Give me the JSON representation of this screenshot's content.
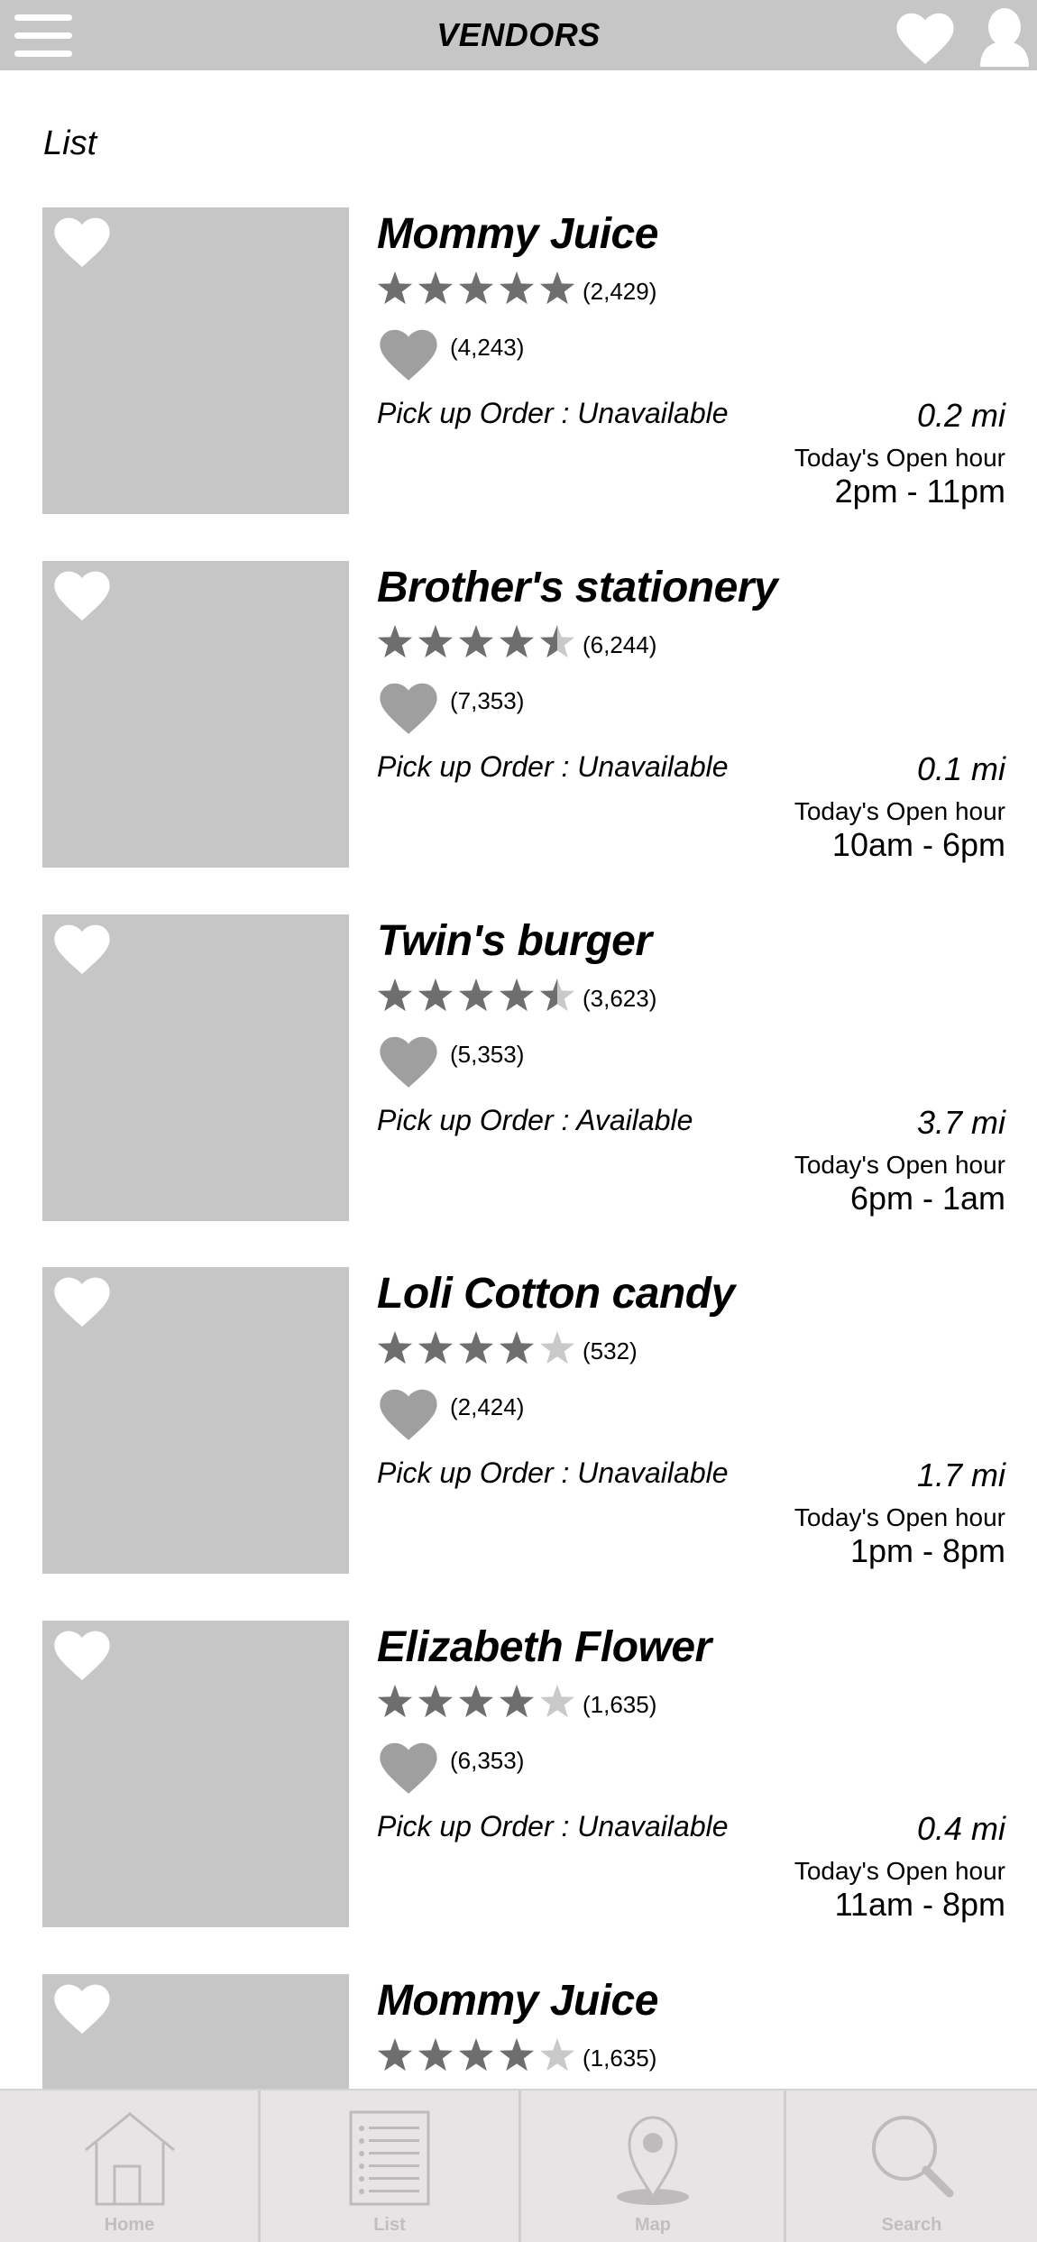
{
  "header": {
    "title": "VENDORS"
  },
  "section_label": "List",
  "vendors": [
    {
      "name": "Mommy Juice",
      "rating": 5,
      "rating_count": "(2,429)",
      "likes": "(4,243)",
      "pickup": "Pick up Order : Unavailable",
      "distance": "0.2 mi",
      "hours_label": "Today's Open hour",
      "hours": "2pm - 11pm"
    },
    {
      "name": "Brother's stationery",
      "rating": 4.5,
      "rating_count": "(6,244)",
      "likes": "(7,353)",
      "pickup": "Pick up Order : Unavailable",
      "distance": "0.1 mi",
      "hours_label": "Today's Open hour",
      "hours": "10am - 6pm"
    },
    {
      "name": "Twin's burger",
      "rating": 4.5,
      "rating_count": "(3,623)",
      "likes": "(5,353)",
      "pickup": "Pick up Order : Available",
      "distance": "3.7 mi",
      "hours_label": "Today's Open hour",
      "hours": "6pm - 1am"
    },
    {
      "name": "Loli Cotton candy",
      "rating": 4,
      "rating_count": "(532)",
      "likes": "(2,424)",
      "pickup": "Pick up Order : Unavailable",
      "distance": "1.7 mi",
      "hours_label": "Today's Open hour",
      "hours": "1pm - 8pm"
    },
    {
      "name": "Elizabeth Flower",
      "rating": 4,
      "rating_count": "(1,635)",
      "likes": "(6,353)",
      "pickup": "Pick up Order : Unavailable",
      "distance": "0.4 mi",
      "hours_label": "Today's Open hour",
      "hours": "11am - 8pm"
    },
    {
      "name": "Mommy Juice",
      "rating": 4,
      "rating_count": "(1,635)"
    }
  ],
  "nav": {
    "items": [
      {
        "label": "Home",
        "icon": "home-icon"
      },
      {
        "label": "List",
        "icon": "list-icon"
      },
      {
        "label": "Map",
        "icon": "map-pin-icon"
      },
      {
        "label": "Search",
        "icon": "search-icon"
      }
    ]
  },
  "colors": {
    "header_bg": "#c6c6c6",
    "placeholder": "#c6c6c6",
    "star_filled": "#6e6e6e",
    "star_empty": "#c9c9c9",
    "heart": "#9f9f9f",
    "nav_bg": "#e6e4e4",
    "nav_icon": "#bdbbbb"
  }
}
